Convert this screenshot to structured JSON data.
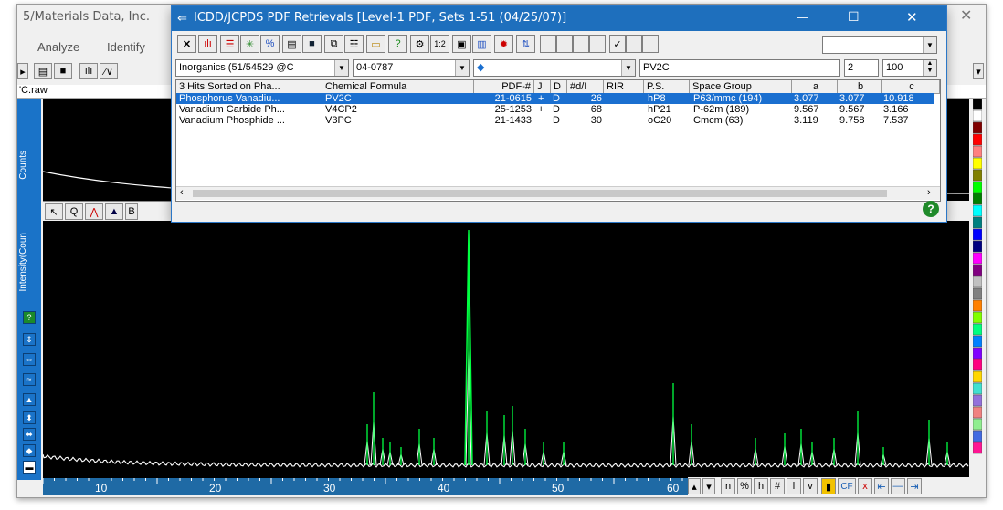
{
  "main_window": {
    "title": "5/Materials Data, Inc.",
    "menu": {
      "analyze": "Analyze",
      "identify": "Identify"
    },
    "file_tab": "'C.raw",
    "y_axis_top_label": "Counts",
    "y_axis_bottom_label": "Intensity(Coun",
    "x_ticks": [
      "10",
      "20",
      "30",
      "40",
      "50",
      "60"
    ],
    "status_buttons": [
      "n",
      "%",
      "h",
      "#",
      "l",
      "v",
      "CF",
      "x"
    ]
  },
  "dialog": {
    "title": "ICDD/JCPDS PDF Retrievals [Level-1 PDF, Sets 1-51 (04/25/07)]",
    "toolbar": {
      "ratio_label": "1:2",
      "right_dropdown_value": ""
    },
    "filters": {
      "database": "Inorganics (51/54529 @C",
      "pdf_number": "04-0787",
      "element_field": "",
      "formula": "PV2C",
      "count_value": "2",
      "max_value": "100"
    },
    "table": {
      "headers": [
        "3 Hits Sorted on Pha...",
        "Chemical Formula",
        "PDF-#",
        "J",
        "D",
        "#d/I",
        "RIR",
        "P.S.",
        "Space Group",
        "a",
        "b",
        "c"
      ],
      "rows": [
        [
          "Phosphorus Vanadiu...",
          "PV2C",
          "21-0615",
          "+",
          "D",
          "26",
          "",
          "hP8",
          "P63/mmc (194)",
          "3.077",
          "3.077",
          "10.918"
        ],
        [
          "Vanadium Carbide Ph...",
          "V4CP2",
          "25-1253",
          "+",
          "D",
          "68",
          "",
          "hP21",
          "P-62m (189)",
          "9.567",
          "9.567",
          "3.166"
        ],
        [
          "Vanadium Phosphide ...",
          "V3PC",
          "21-1433",
          "",
          "D",
          "30",
          "",
          "oC20",
          "Cmcm (63)",
          "3.119",
          "9.758",
          "7.537"
        ]
      ],
      "selected_row": 0
    },
    "window_controls": {
      "minimize": "—",
      "maximize": "☐",
      "close": "✕"
    },
    "help_label": "?"
  },
  "colors": {
    "dialog_title_bg": "#1e6fbd",
    "plot_bg": "#000000",
    "trace_black": "#ffffff",
    "trace_green": "#00ff40",
    "selection": "#1a6fd0"
  }
}
